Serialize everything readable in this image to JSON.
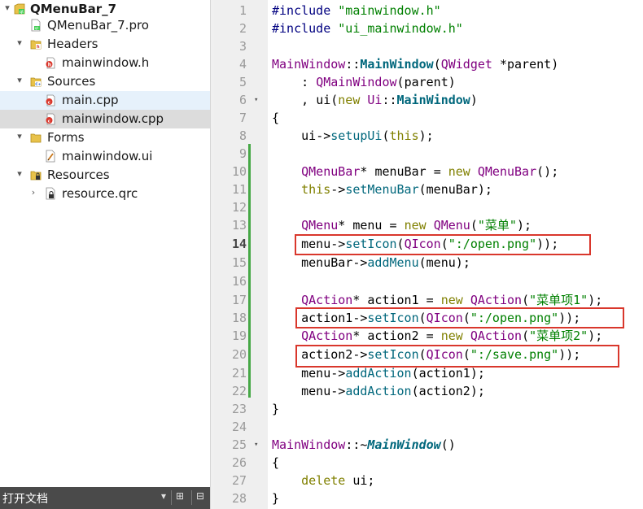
{
  "tree": {
    "items": [
      {
        "label": "QMenuBar_7",
        "icon": "qt-project-icon",
        "arrow": "▾",
        "indent": 0,
        "bold": true
      },
      {
        "label": "QMenuBar_7.pro",
        "icon": "pro-file-icon",
        "arrow": "",
        "indent": 1,
        "bold": false
      },
      {
        "label": "Headers",
        "icon": "headers-folder-icon",
        "arrow": "▾",
        "indent": 1,
        "bold": false
      },
      {
        "label": "mainwindow.h",
        "icon": "header-file-icon",
        "arrow": "",
        "indent": 2,
        "bold": false
      },
      {
        "label": "Sources",
        "icon": "sources-folder-icon",
        "arrow": "▾",
        "indent": 1,
        "bold": false
      },
      {
        "label": "main.cpp",
        "icon": "cpp-file-icon",
        "arrow": "",
        "indent": 2,
        "bold": false
      },
      {
        "label": "mainwindow.cpp",
        "icon": "cpp-file-icon",
        "arrow": "",
        "indent": 2,
        "bold": false
      },
      {
        "label": "Forms",
        "icon": "forms-folder-icon",
        "arrow": "▾",
        "indent": 1,
        "bold": false
      },
      {
        "label": "mainwindow.ui",
        "icon": "ui-file-icon",
        "arrow": "",
        "indent": 2,
        "bold": false
      },
      {
        "label": "Resources",
        "icon": "resources-folder-icon",
        "arrow": "▾",
        "indent": 1,
        "bold": false
      },
      {
        "label": "resource.qrc",
        "icon": "qrc-file-icon",
        "arrow": "›",
        "indent": 2,
        "bold": false
      }
    ]
  },
  "open_documents": {
    "title": "打开文档",
    "dropdown": "▾",
    "split": "⊞",
    "close": "⊟"
  },
  "editor": {
    "current_line": "14",
    "lines": [
      {
        "n": "1",
        "fold": "",
        "text": "#include \"mainwindow.h\""
      },
      {
        "n": "2",
        "fold": "",
        "text": "#include \"ui_mainwindow.h\""
      },
      {
        "n": "3",
        "fold": "",
        "text": ""
      },
      {
        "n": "4",
        "fold": "",
        "text": "MainWindow::MainWindow(QWidget *parent)"
      },
      {
        "n": "5",
        "fold": "",
        "text": "    : QMainWindow(parent)"
      },
      {
        "n": "6",
        "fold": "▾",
        "text": "    , ui(new Ui::MainWindow)"
      },
      {
        "n": "7",
        "fold": "",
        "text": "{"
      },
      {
        "n": "8",
        "fold": "",
        "text": "    ui->setupUi(this);"
      },
      {
        "n": "9",
        "fold": "",
        "text": ""
      },
      {
        "n": "10",
        "fold": "",
        "text": "    QMenuBar* menuBar = new QMenuBar();"
      },
      {
        "n": "11",
        "fold": "",
        "text": "    this->setMenuBar(menuBar);"
      },
      {
        "n": "12",
        "fold": "",
        "text": ""
      },
      {
        "n": "13",
        "fold": "",
        "text": "    QMenu* menu = new QMenu(\"菜单\");"
      },
      {
        "n": "14",
        "fold": "",
        "text": "    menu->setIcon(QIcon(\":/open.png\"));"
      },
      {
        "n": "15",
        "fold": "",
        "text": "    menuBar->addMenu(menu);"
      },
      {
        "n": "16",
        "fold": "",
        "text": ""
      },
      {
        "n": "17",
        "fold": "",
        "text": "    QAction* action1 = new QAction(\"菜单项1\");"
      },
      {
        "n": "18",
        "fold": "",
        "text": "    action1->setIcon(QIcon(\":/open.png\"));"
      },
      {
        "n": "19",
        "fold": "",
        "text": "    QAction* action2 = new QAction(\"菜单项2\");"
      },
      {
        "n": "20",
        "fold": "",
        "text": "    action2->setIcon(QIcon(\":/save.png\"));"
      },
      {
        "n": "21",
        "fold": "",
        "text": "    menu->addAction(action1);"
      },
      {
        "n": "22",
        "fold": "",
        "text": "    menu->addAction(action2);"
      },
      {
        "n": "23",
        "fold": "",
        "text": "}"
      },
      {
        "n": "24",
        "fold": "",
        "text": ""
      },
      {
        "n": "25",
        "fold": "▾",
        "text": "MainWindow::~MainWindow()"
      },
      {
        "n": "26",
        "fold": "",
        "text": "{"
      },
      {
        "n": "27",
        "fold": "",
        "text": "    delete ui;"
      },
      {
        "n": "28",
        "fold": "",
        "text": "}"
      }
    ],
    "highlighted_lines": [
      "14",
      "18",
      "20"
    ],
    "highlight_color": "#d9372c",
    "modified_bar_color": "#46a846"
  }
}
